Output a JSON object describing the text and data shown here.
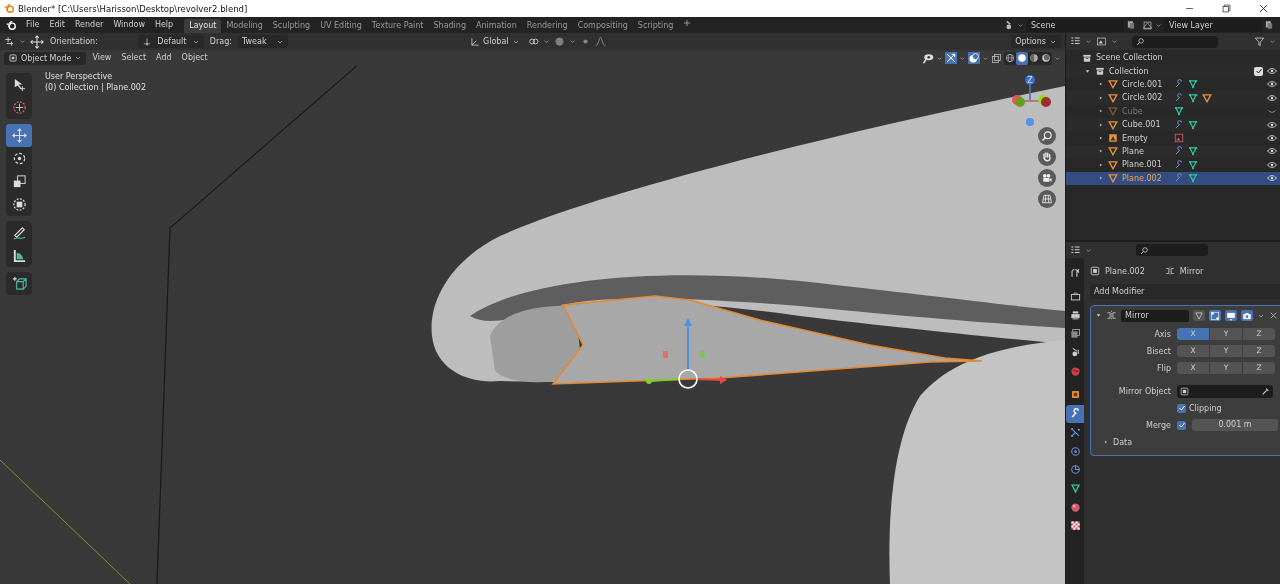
{
  "window": {
    "title": "Blender* [C:\\Users\\Harisson\\Desktop\\revolver2.blend]"
  },
  "menu": [
    "File",
    "Edit",
    "Render",
    "Window",
    "Help"
  ],
  "workspace_tabs": [
    {
      "label": "Layout",
      "selected": true
    },
    {
      "label": "Modeling",
      "selected": false
    },
    {
      "label": "Sculpting",
      "selected": false
    },
    {
      "label": "UV Editing",
      "selected": false
    },
    {
      "label": "Texture Paint",
      "selected": false
    },
    {
      "label": "Shading",
      "selected": false
    },
    {
      "label": "Animation",
      "selected": false
    },
    {
      "label": "Rendering",
      "selected": false
    },
    {
      "label": "Compositing",
      "selected": false
    },
    {
      "label": "Scripting",
      "selected": false
    }
  ],
  "scene": {
    "value": "Scene"
  },
  "view_layer": {
    "value": "View Layer"
  },
  "tool_header": {
    "orientation_label": "Orientation:",
    "orientation": "Default",
    "drag_label": "Drag:",
    "drag": "Tweak",
    "transform_orientation": "Global",
    "options": "Options"
  },
  "viewport_header": {
    "mode": "Object Mode",
    "menus": [
      "View",
      "Select",
      "Add",
      "Object"
    ],
    "shading_modes": [
      {
        "kind": "wireframe",
        "selected": false
      },
      {
        "kind": "solid",
        "selected": true
      },
      {
        "kind": "material",
        "selected": false
      },
      {
        "kind": "rendered",
        "selected": false
      }
    ]
  },
  "tool_groups": [
    {
      "tools": [
        {
          "kind": "select",
          "selected": false
        },
        {
          "kind": "cursor",
          "selected": false
        }
      ]
    },
    {
      "tools": [
        {
          "kind": "move",
          "selected": true
        },
        {
          "kind": "rotate",
          "selected": false
        },
        {
          "kind": "scale",
          "selected": false
        },
        {
          "kind": "transform",
          "selected": false
        }
      ]
    },
    {
      "tools": [
        {
          "kind": "annotate",
          "selected": false
        },
        {
          "kind": "measure",
          "selected": false
        }
      ]
    },
    {
      "tools": [
        {
          "kind": "add_cube",
          "selected": false
        }
      ]
    }
  ],
  "viewport_overlay": {
    "view": "User Perspective",
    "context": "(0) Collection | Plane.002"
  },
  "navigation_gizmo": {
    "axis_label": "Z"
  },
  "navigation_buttons": [
    {
      "kind": "zoom"
    },
    {
      "kind": "pan"
    },
    {
      "kind": "camera"
    },
    {
      "kind": "ortho"
    }
  ],
  "outliner": {
    "root": "Scene Collection",
    "collection": {
      "label": "Collection",
      "checked": true,
      "expanded": true,
      "children": [
        {
          "label": "Circle.001",
          "kind": "mesh",
          "hidden": false,
          "selected": false,
          "extras": [
            {
              "kind": "modifier"
            },
            {
              "kind": "mesh_data"
            }
          ]
        },
        {
          "label": "Circle.002",
          "kind": "mesh",
          "hidden": false,
          "selected": false,
          "extras": [
            {
              "kind": "modifier"
            },
            {
              "kind": "mesh_data"
            },
            {
              "kind": "mesh"
            }
          ]
        },
        {
          "label": "Cube",
          "kind": "mesh",
          "hidden": true,
          "selected": false,
          "extras": [
            {
              "kind": "mesh_data"
            }
          ]
        },
        {
          "label": "Cube.001",
          "kind": "mesh",
          "hidden": false,
          "selected": false,
          "extras": [
            {
              "kind": "modifier"
            },
            {
              "kind": "mesh_data"
            }
          ]
        },
        {
          "label": "Empty",
          "kind": "empty",
          "hidden": false,
          "selected": false,
          "extras": [
            {
              "kind": "image"
            }
          ]
        },
        {
          "label": "Plane",
          "kind": "mesh",
          "hidden": false,
          "selected": false,
          "extras": [
            {
              "kind": "modifier"
            },
            {
              "kind": "mesh_data"
            }
          ]
        },
        {
          "label": "Plane.001",
          "kind": "mesh",
          "hidden": false,
          "selected": false,
          "extras": [
            {
              "kind": "modifier"
            },
            {
              "kind": "mesh_data"
            }
          ]
        },
        {
          "label": "Plane.002",
          "kind": "mesh",
          "hidden": false,
          "selected": true,
          "extras": [
            {
              "kind": "modifier"
            },
            {
              "kind": "mesh_data"
            }
          ]
        }
      ]
    }
  },
  "properties": {
    "tabs": [
      {
        "kind": "tool",
        "selected": false
      },
      {
        "kind": "render",
        "selected": false
      },
      {
        "kind": "output",
        "selected": false
      },
      {
        "kind": "view_layer",
        "selected": false
      },
      {
        "kind": "scene",
        "selected": false
      },
      {
        "kind": "world",
        "selected": false
      },
      {
        "kind": "object",
        "selected": false
      },
      {
        "kind": "modifier",
        "selected": true
      },
      {
        "kind": "particles",
        "selected": false
      },
      {
        "kind": "physics",
        "selected": false
      },
      {
        "kind": "constraints",
        "selected": false
      },
      {
        "kind": "data",
        "selected": false
      },
      {
        "kind": "material",
        "selected": false
      },
      {
        "kind": "texture",
        "selected": false
      }
    ],
    "object": "Plane.002",
    "context": "Mirror",
    "add_modifier": "Add Modifier",
    "modifier": {
      "name": "Mirror",
      "expanded": true,
      "rows": [
        {
          "label": "Axis",
          "buttons": [
            {
              "label": "X",
              "selected": true
            },
            {
              "label": "Y",
              "selected": false
            },
            {
              "label": "Z",
              "selected": false
            }
          ]
        },
        {
          "label": "Bisect",
          "buttons": [
            {
              "label": "X",
              "selected": false
            },
            {
              "label": "Y",
              "selected": false
            },
            {
              "label": "Z",
              "selected": false
            }
          ]
        },
        {
          "label": "Flip",
          "buttons": [
            {
              "label": "X",
              "selected": false
            },
            {
              "label": "Y",
              "selected": false
            },
            {
              "label": "Z",
              "selected": false
            }
          ]
        }
      ],
      "mirror_object_label": "Mirror Object",
      "clipping": {
        "label": "Clipping",
        "checked": true
      },
      "merge": {
        "label": "Merge",
        "checked": true,
        "value": "0.001 m"
      },
      "data_panel": {
        "label": "Data",
        "expanded": false
      }
    }
  }
}
